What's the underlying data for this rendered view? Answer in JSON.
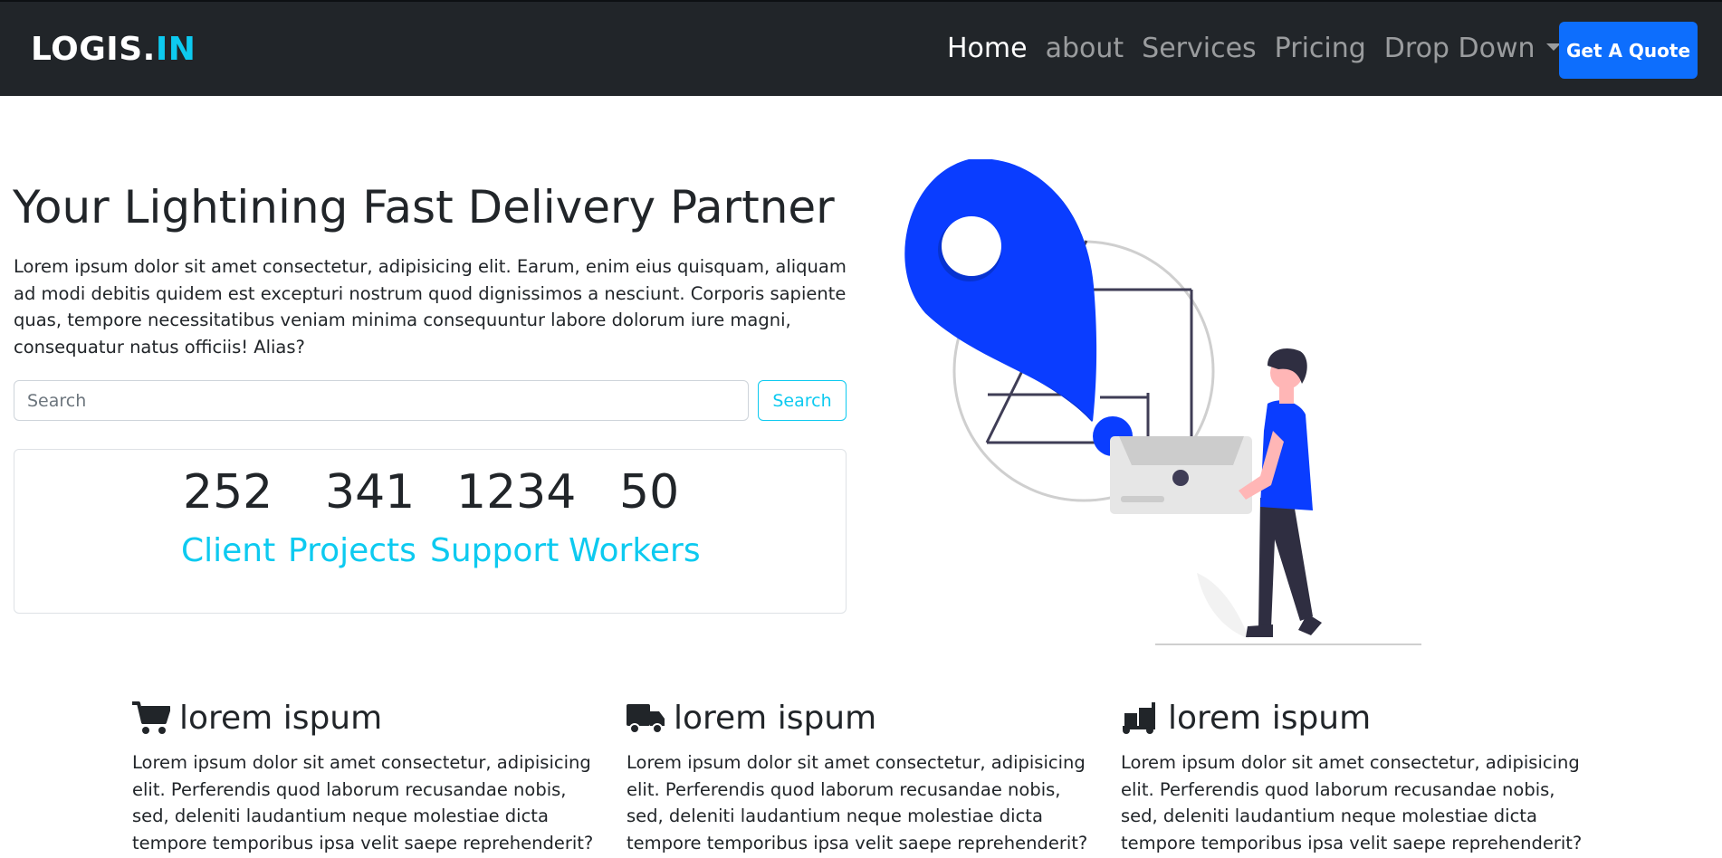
{
  "navbar": {
    "brand_main": "LOGIS.",
    "brand_accent": "IN",
    "links": [
      {
        "label": "Home"
      },
      {
        "label": "about"
      },
      {
        "label": "Services"
      },
      {
        "label": "Pricing"
      },
      {
        "label": "Drop Down"
      }
    ],
    "cta_label": "Get A Quote"
  },
  "hero": {
    "title": "Your Lightining Fast Delivery Partner",
    "text": "Lorem ipsum dolor sit amet consectetur, adipisicing elit. Earum, enim eius quisquam, aliquam ad modi debitis quidem est excepturi nostrum quod dignissimos a nesciunt. Corporis sapiente quas, tempore necessitatibus veniam minima consequuntur labore dolorum iure magni, consequatur natus officiis! Alias?",
    "search_placeholder": "Search",
    "search_button": "Search"
  },
  "stats": [
    {
      "number": "252",
      "label": "Client"
    },
    {
      "number": "341",
      "label": "Projects"
    },
    {
      "number": "1234",
      "label": "Support"
    },
    {
      "number": "50",
      "label": "Workers"
    }
  ],
  "features": [
    {
      "icon": "cart-icon",
      "title": "lorem ispum",
      "text": "Lorem ipsum dolor sit amet consectetur, adipisicing elit. Perferendis quod laborum recusandae nobis, sed, deleniti laudantium neque molestiae dicta tempore temporibus ipsa velit saepe reprehenderit?"
    },
    {
      "icon": "truck-icon",
      "title": "lorem ispum",
      "text": "Lorem ipsum dolor sit amet consectetur, adipisicing elit. Perferendis quod laborum recusandae nobis, sed, deleniti laudantium neque molestiae dicta tempore temporibus ipsa velit saepe reprehenderit?"
    },
    {
      "icon": "dolly-icon",
      "title": "lorem ispum",
      "text": "Lorem ipsum dolor sit amet consectetur, adipisicing elit. Perferendis quod laborum recusandae nobis, sed, deleniti laudantium neque molestiae dicta tempore temporibus ipsa velit saepe reprehenderit?"
    }
  ],
  "colors": {
    "navbar_bg": "#212529",
    "accent": "#0dcaf0",
    "primary": "#0d6efd",
    "illustration_blue": "#0a3dff"
  }
}
